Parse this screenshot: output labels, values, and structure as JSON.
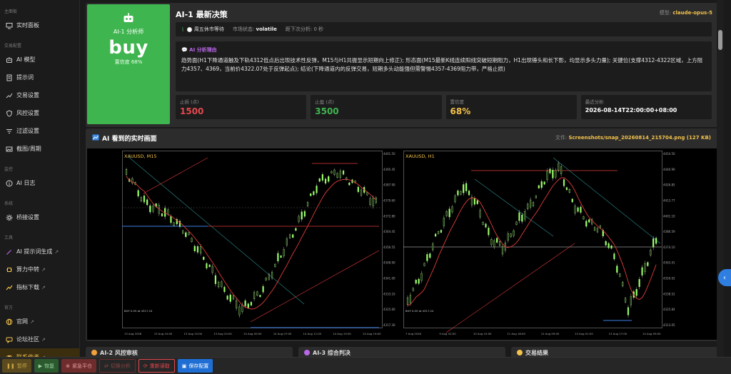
{
  "sidebar": {
    "sections": [
      {
        "title": "主面板",
        "items": [
          {
            "label": "实时面板",
            "icon": "monitor-icon"
          }
        ]
      },
      {
        "title": "交易配置",
        "items": [
          {
            "label": "AI 模型",
            "icon": "robot-icon"
          },
          {
            "label": "提示词",
            "icon": "document-icon"
          },
          {
            "label": "交易设置",
            "icon": "chart-line-icon"
          },
          {
            "label": "风控设置",
            "icon": "shield-icon"
          },
          {
            "label": "过滤设置",
            "icon": "filter-icon"
          },
          {
            "label": "截图/周期",
            "icon": "image-icon"
          }
        ]
      },
      {
        "title": "监控",
        "items": [
          {
            "label": "AI 日志",
            "icon": "info-icon"
          }
        ]
      },
      {
        "title": "系统",
        "items": [
          {
            "label": "桥接设置",
            "icon": "gear-icon"
          }
        ]
      },
      {
        "title": "工具",
        "items": [
          {
            "label": "AI 提示词生成",
            "icon": "wand-icon",
            "external": true
          },
          {
            "label": "算力中转",
            "icon": "chip-icon",
            "external": true
          },
          {
            "label": "指标下载",
            "icon": "trend-icon",
            "external": true
          }
        ]
      },
      {
        "title": "官方",
        "items": [
          {
            "label": "官网",
            "icon": "globe-icon",
            "external": true
          },
          {
            "label": "论坛社区",
            "icon": "forum-icon",
            "external": true
          },
          {
            "label": "联系作者",
            "icon": "contact-icon",
            "external": true,
            "active": true
          }
        ]
      }
    ]
  },
  "decision": {
    "title": "AI-1 最新决策",
    "model_label": "模型:",
    "model": "claude-opus-5",
    "card_label": "AI-1 分析师",
    "action": "buy",
    "confidence_text": "置信度 68%",
    "status": {
      "state": "周五休市等待",
      "market_label": "市场状态:",
      "market_value": "volatile",
      "next_label": "距下次分析: 0 秒"
    },
    "reason_title": "AI 分析理由",
    "reason_text": "趋势面(H1下降通道触及下轨4312低点后出现技术性反弹，M15与H1共振显示短期向上修正); 形态面(M15最新K线连续阳线突破短期阻力，H1出现锤头和长下影，均显示多头力量); 关键位(支撑4312-4322区域，上方阻力4357、4369，当前价4322.07处于反弹起点); 结论(下降通道内的反弹交易，短期多头动能强但需警惕4357-4369阻力带，严格止损)",
    "stats": [
      {
        "label": "止损 (点)",
        "value": "1500",
        "tone": "red"
      },
      {
        "label": "止盈 (点)",
        "value": "3500",
        "tone": "green"
      },
      {
        "label": "置信度",
        "value": "68%",
        "tone": "yellow"
      },
      {
        "label": "最近分析",
        "value": "2026-08-14T22:00:00+08:00",
        "tone": "white"
      }
    ]
  },
  "chart_panel": {
    "title": "AI 看到的实时画面",
    "file_label": "文件:",
    "file_value": "Screenshots/snap_20260814_215704.png (127 KB)",
    "left": {
      "label": "XAUUSD, M15",
      "ticks": [
        "4401.50",
        "4395.45",
        "4387.90",
        "4379.60",
        "4372.80",
        "4364.45",
        "4356.55",
        "4348.90",
        "4341.00",
        "4333.10",
        "4325.60",
        "4317.30"
      ],
      "xticks": [
        "13 Aug 2026",
        "13 Aug 10:00",
        "13 Aug 15:00",
        "13 Aug 20:00",
        "14 Aug 00:00",
        "14 Aug 07:00",
        "14 Aug 11:00",
        "14 Aug 15:00",
        "14 Aug 19:00"
      ],
      "info": "BUY 0.05 at 4317.24"
    },
    "right": {
      "label": "XAUUSD, H1",
      "ticks": [
        "4454.50",
        "4440.90",
        "4426.85",
        "4413.77",
        "4401.10",
        "4386.59",
        "4374.10",
        "4363.41",
        "4350.02",
        "4338.52",
        "4325.84",
        "4313.05"
      ],
      "xticks": [
        "7 Aug 2026",
        "9 Aug 02:00",
        "10 Aug 10:00",
        "11 Aug 18:00",
        "12 Aug 09:00",
        "13 Aug 01:00",
        "13 Aug 17:00",
        "14 Aug 09:00"
      ],
      "info": "BUY 0.05 at 4317.24"
    }
  },
  "bottom_cards": [
    "AI-2 风控审核",
    "AI-3 综合判决",
    "交易结果"
  ],
  "toolbar": {
    "pause": "暂停",
    "resume": "恢复",
    "close_all": "紧急平仓",
    "switch": "切换分析",
    "refresh": "重新读取",
    "save": "保存配置"
  },
  "colors": {
    "buy_green": "#3fb54f",
    "accent_yellow": "#f3c24b",
    "danger_red": "#e5484d",
    "primary_blue": "#1f6ed4",
    "reason_purple": "#b967e8"
  }
}
